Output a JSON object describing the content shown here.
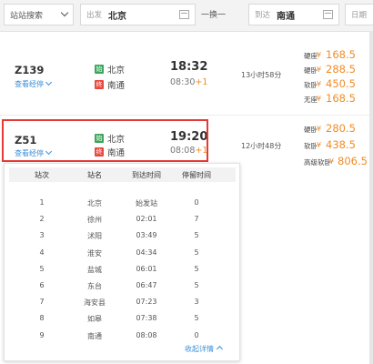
{
  "search": {
    "type_label": "站站搜索",
    "from_label": "出发",
    "from_value": "北京",
    "swap_label": "一换一",
    "to_label": "到达",
    "to_value": "南通",
    "date_label": "日期"
  },
  "trains": [
    {
      "code": "Z139",
      "route_link": "查看经停",
      "from_badge": "始",
      "from_station": "北京",
      "depart_time": "18:32",
      "to_badge": "终",
      "to_station": "南通",
      "arrive_time": "08:30",
      "day_offset": "+1",
      "duration": "13小时58分",
      "seats": [
        {
          "name": "硬座",
          "yen": "¥",
          "price": "168.5"
        },
        {
          "name": "硬卧",
          "yen": "¥",
          "price": "288.5"
        },
        {
          "name": "软卧",
          "yen": "¥",
          "price": "450.5"
        },
        {
          "name": "无座",
          "yen": "¥",
          "price": "168.5"
        }
      ]
    },
    {
      "code": "Z51",
      "route_link": "查看经停",
      "from_badge": "始",
      "from_station": "北京",
      "depart_time": "19:20",
      "to_badge": "终",
      "to_station": "南通",
      "arrive_time": "08:08",
      "day_offset": "+1",
      "duration": "12小时48分",
      "seats": [
        {
          "name": "硬卧",
          "yen": "¥",
          "price": "280.5"
        },
        {
          "name": "软卧",
          "yen": "¥",
          "price": "438.5"
        },
        {
          "name": "高级软卧",
          "yen": "¥",
          "price": "806.5"
        }
      ]
    }
  ],
  "stops_panel": {
    "headers": [
      "站次",
      "站名",
      "到达时间",
      "停留时间"
    ],
    "rows": [
      [
        "1",
        "北京",
        "始发站",
        "0"
      ],
      [
        "2",
        "徐州",
        "02:01",
        "7"
      ],
      [
        "3",
        "沭阳",
        "03:49",
        "5"
      ],
      [
        "4",
        "淮安",
        "04:34",
        "5"
      ],
      [
        "5",
        "盐城",
        "06:01",
        "5"
      ],
      [
        "6",
        "东台",
        "06:47",
        "5"
      ],
      [
        "7",
        "海安县",
        "07:23",
        "3"
      ],
      [
        "8",
        "如皋",
        "07:38",
        "5"
      ],
      [
        "9",
        "南通",
        "08:08",
        "0"
      ]
    ],
    "collapse_label": "收起详情"
  }
}
